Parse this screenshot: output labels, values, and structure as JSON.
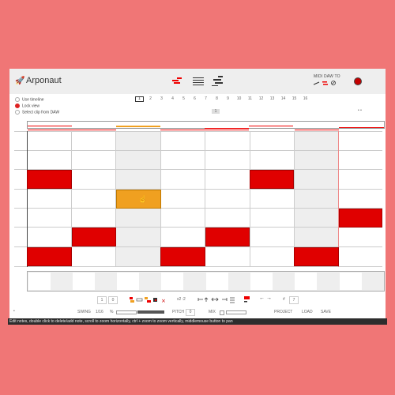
{
  "app": {
    "title": "Arponaut"
  },
  "header": {
    "midi_label": "MIDI DAW TO"
  },
  "options": [
    "Use timeline",
    "Lock view",
    "Select clip from DAW"
  ],
  "selected_option": 1,
  "pages": [
    "1",
    "2",
    "3",
    "4",
    "5",
    "6",
    "7",
    "8",
    "9",
    "10",
    "11",
    "12",
    "13",
    "14",
    "15",
    "16"
  ],
  "active_page": 0,
  "current_marker": "1",
  "dots": "• •",
  "colors": {
    "background": "#f07676",
    "note": "#e00000",
    "selected_note": "#f0a020"
  },
  "toolbar": {
    "val_a": "1",
    "val_b": "0",
    "transpose": "x2 :2",
    "hash": "#",
    "hash_value": "7"
  },
  "settings": {
    "swing_label": "SWING",
    "swing_value": "1/16",
    "swing_pct": "%",
    "pitch_label": "PITCH",
    "pitch_value": "0",
    "mix_label": "MIX",
    "project": "PROJECT",
    "load": "LOAD",
    "save": "SAVE"
  },
  "status": "Edit notes, double click to delete/add note, scroll to zoom horizontally, ctrl + zoom to zoom vertically, middlemouse button to pan"
}
